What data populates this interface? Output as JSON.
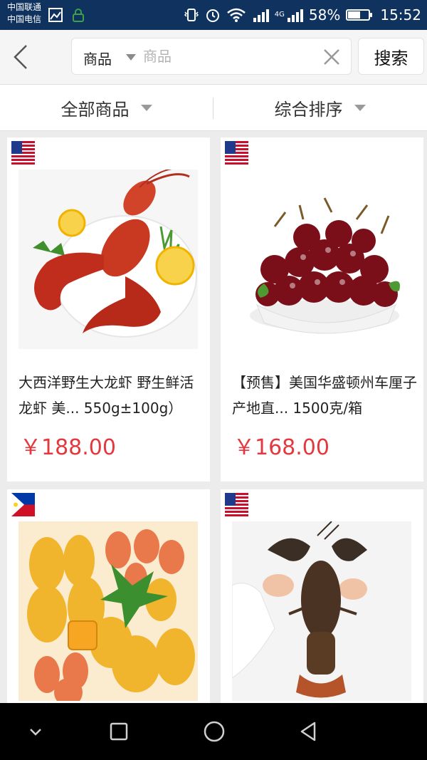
{
  "status_bar": {
    "carrier_1": "中国联通",
    "carrier_2": "中国电信",
    "network_label": "4G",
    "battery_text": "58%",
    "battery_level": 0.58,
    "time": "15:52"
  },
  "header": {
    "scope_label": "商品",
    "search_placeholder": "商品",
    "search_value": "",
    "search_button": "搜索"
  },
  "filters": {
    "category": "全部商品",
    "sort": "综合排序"
  },
  "products": [
    {
      "title": "大西洋野生大龙虾 野生鲜活龙虾 美... 550g±100g）",
      "price": "￥188.00",
      "flag": "usa-flag-icon",
      "image": "lobster-image"
    },
    {
      "title": "【预售】美国华盛顿州车厘子 产地直... 1500克/箱",
      "price": "￥168.00",
      "flag": "usa-flag-icon",
      "image": "cherries-image"
    },
    {
      "title": "",
      "price": "",
      "flag": "philippines-flag-icon",
      "image": "mangoes-image"
    },
    {
      "title": "",
      "price": "",
      "flag": "usa-flag-icon",
      "image": "live-lobster-image"
    }
  ],
  "colors": {
    "status_bar": "#10325f",
    "price": "#e4383f",
    "page_background": "#ececec"
  }
}
